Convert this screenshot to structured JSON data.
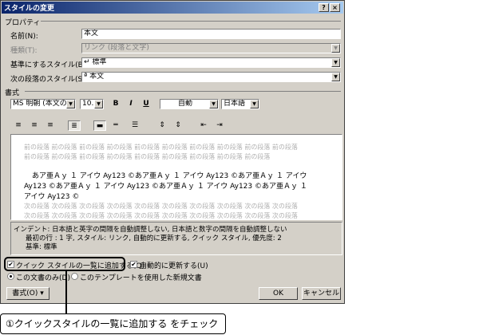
{
  "dialog": {
    "title": "スタイルの変更",
    "help_glyph": "?",
    "close_glyph": "×"
  },
  "properties": {
    "heading": "プロパティ",
    "name_label": "名前(N):",
    "name_value": "本文",
    "type_label": "種類(T):",
    "type_value": "リンク (段落と文字)",
    "base_label": "基準にするスタイル(B):",
    "base_value": "↵ 標準",
    "next_label": "次の段落のスタイル(S):",
    "next_value": "ª 本文"
  },
  "format": {
    "heading": "書式",
    "font_value": "MS 明朝 (本文の)",
    "size_value": "10.5",
    "bold_glyph": "B",
    "italic_glyph": "I",
    "underline_glyph": "U",
    "color_value": "自動",
    "lang_value": "日本語"
  },
  "preview": {
    "prev_line_1": "前の段落 前の段落 前の段落 前の段落 前の段落 前の段落 前の段落 前の段落 前の段落 前の段落",
    "prev_line_2": "前の段落 前の段落 前の段落 前の段落 前の段落 前の段落 前の段落 前の段落 前の段落",
    "main_line_1": "あア亜Ａｙ １ アイウ Ay123 ©あア亜Ａｙ １ アイウ Ay123 ©あア亜Ａｙ １ アイウ",
    "main_line_2": "Ay123 ©あア亜Ａｙ １ アイウ Ay123 ©あア亜Ａｙ １ アイウ Ay123 ©あア亜Ａｙ １",
    "main_line_3": "アイウ Ay123 ©",
    "next_line_1": "次の段落 次の段落 次の段落 次の段落 次の段落 次の段落 次の段落 次の段落 次の段落 次の段落",
    "next_line_2": "次の段落 次の段落 次の段落 次の段落 次の段落 次の段落 次の段落 次の段落 次の段落 次の段落"
  },
  "description": {
    "line_1": "インデント: 日本語と英字の間隔を自動調整しない, 日本語と数字の間隔を自動調整しない",
    "line_2": "最初の行 :  1 字, スタイル: リンク, 自動的に更新する, クイック スタイル, 優先度: 2",
    "line_3": "基準: 標準"
  },
  "options": {
    "quick_style_label": "クイック スタイルの一覧に追加する(Q)",
    "auto_update_label": "自動的に更新する(U)",
    "this_doc_label": "この文書のみ(D)",
    "template_label": "このテンプレートを使用した新規文書",
    "check_glyph": "✔"
  },
  "buttons": {
    "format_label": "書式(O) ▾",
    "ok_label": "OK",
    "cancel_label": "キャンセル"
  },
  "callout": {
    "text": "①クイックスタイルの一覧に追加する をチェック"
  }
}
